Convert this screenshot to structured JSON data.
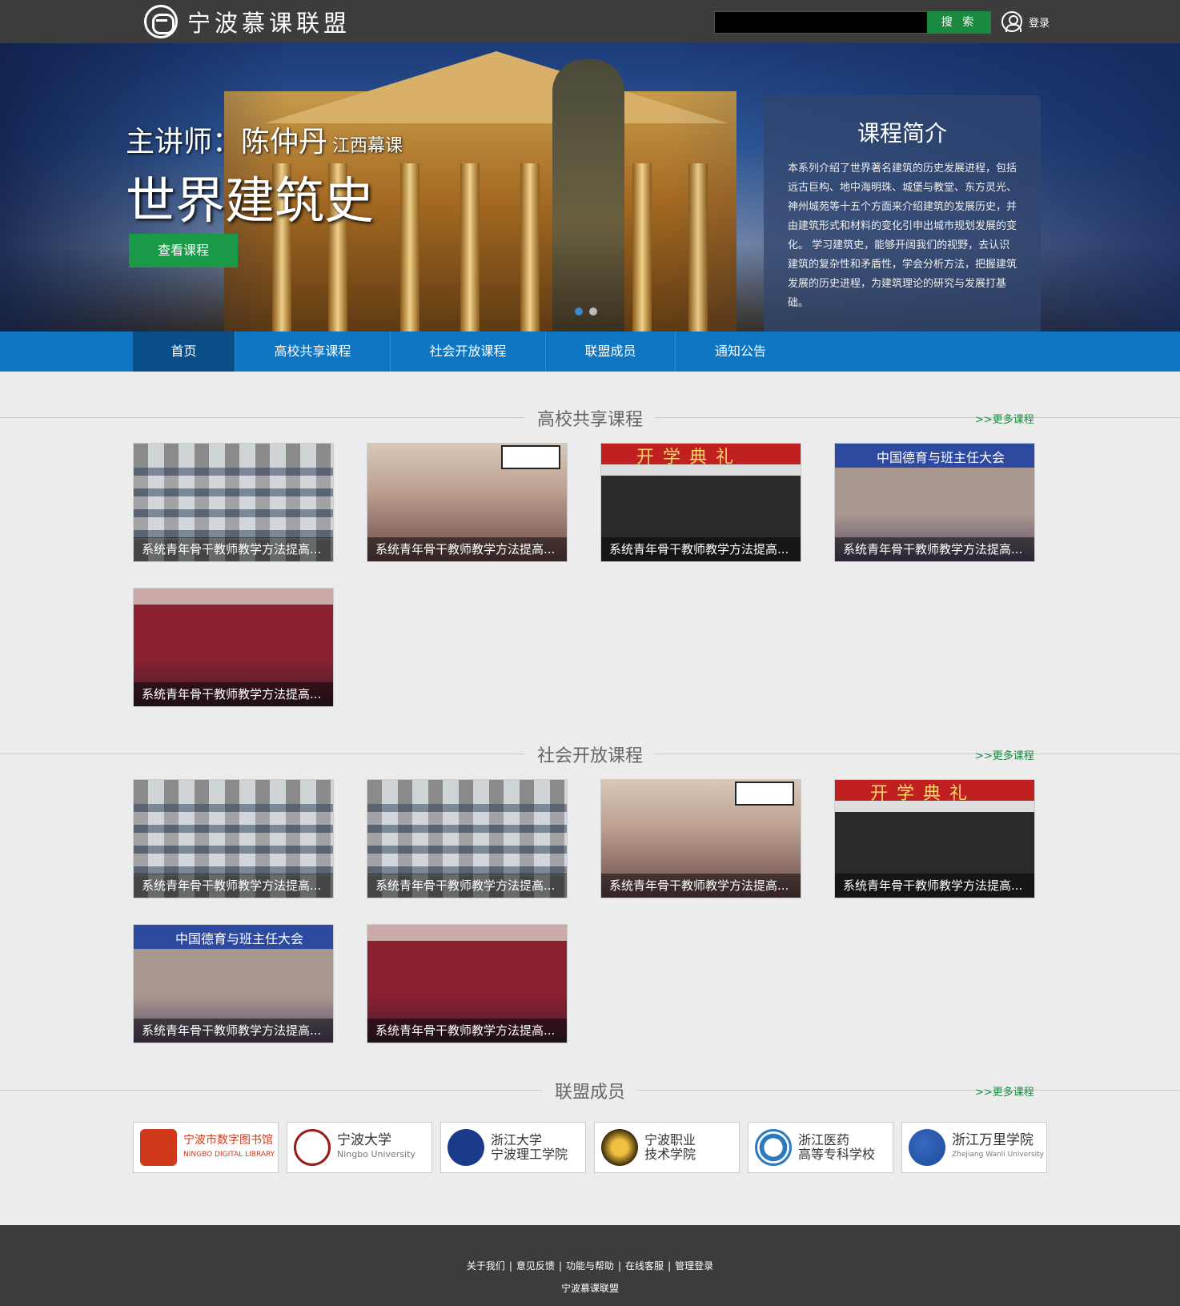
{
  "header": {
    "logo_text": "宁波慕课联盟",
    "search_placeholder": "",
    "search_button": "搜 索",
    "login": "登录"
  },
  "banner": {
    "teacher_label": "主讲师：陈仲丹",
    "teacher_org": "江西幕课",
    "course_title": "世界建筑史",
    "view_button": "查看课程",
    "intro_title": "课程简介",
    "intro_text": "本系列介绍了世界著名建筑的历史发展进程，包括远古巨构、地中海明珠、城堡与教堂、东方灵光、神州城苑等十五个方面来介绍建筑的发展历史，并由建筑形式和材料的变化引申出城市规划发展的变化。 学习建筑史，能够开阔我们的视野，去认识建筑的复杂性和矛盾性，学会分析方法，把握建筑发展的历史进程，为建筑理论的研究与发展打基础。"
  },
  "nav": {
    "items": [
      {
        "label": "首页"
      },
      {
        "label": "高校共享课程"
      },
      {
        "label": "社会开放课程"
      },
      {
        "label": "联盟成员"
      },
      {
        "label": "通知公告"
      }
    ]
  },
  "sections": {
    "university": {
      "title": "高校共享课程",
      "more": ">>更多课程",
      "cards": [
        {
          "caption": "系统青年骨干教师教学方法提高...",
          "image": "computer-lab"
        },
        {
          "caption": "系统青年骨干教师教学方法提高...",
          "image": "teacher-training"
        },
        {
          "caption": "系统青年骨干教师教学方法提高...",
          "image": "opening-ceremony"
        },
        {
          "caption": "系统青年骨干教师教学方法提高...",
          "image": "moral-education-conference"
        },
        {
          "caption": "系统青年骨干教师教学方法提高...",
          "image": "lecture-hall"
        }
      ]
    },
    "social": {
      "title": "社会开放课程",
      "more": ">>更多课程",
      "cards": [
        {
          "caption": "系统青年骨干教师教学方法提高...",
          "image": "computer-lab"
        },
        {
          "caption": "系统青年骨干教师教学方法提高...",
          "image": "computer-lab"
        },
        {
          "caption": "系统青年骨干教师教学方法提高...",
          "image": "teacher-training"
        },
        {
          "caption": "系统青年骨干教师教学方法提高...",
          "image": "opening-ceremony"
        },
        {
          "caption": "系统青年骨干教师教学方法提高...",
          "image": "moral-education-conference"
        },
        {
          "caption": "系统青年骨干教师教学方法提高...",
          "image": "lecture-hall"
        }
      ]
    },
    "members": {
      "title": "联盟成员",
      "more": ">>更多课程",
      "items": [
        {
          "name": "宁波市数字图书馆",
          "sub": "NINGBO DIGITAL LIBRARY",
          "color": "#d03a1a"
        },
        {
          "name": "宁波大学",
          "sub": "Ningbo University",
          "color": "#9a1a1a"
        },
        {
          "name": "浙江大学\n宁波理工学院",
          "sub": "",
          "color": "#1a3a8a"
        },
        {
          "name": "宁波职业\n技术学院",
          "sub": "",
          "color": "#b08a1a"
        },
        {
          "name": "浙江医药\n高等专科学校",
          "sub": "",
          "color": "#2a7ac0"
        },
        {
          "name": "浙江万里学院",
          "sub": "Zhejiang Wanli University",
          "color": "#1a4a9a"
        }
      ]
    }
  },
  "footer": {
    "links": [
      "关于我们",
      "意见反馈",
      "功能与帮助",
      "在线客服",
      "管理登录"
    ],
    "separator": "|",
    "copyright": "宁波慕课联盟"
  },
  "colors": {
    "topbar": "#3c3c3c",
    "nav": "#0e76c3",
    "nav_active": "#0a4e8a",
    "accent_green": "#1a9a48"
  }
}
